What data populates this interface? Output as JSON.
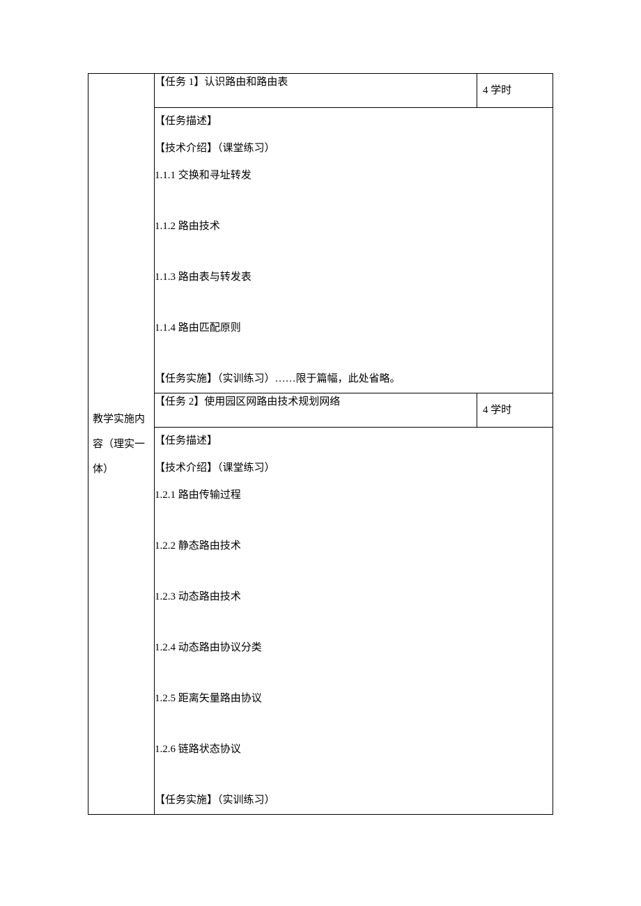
{
  "leftHeader": "教学实施内容（理实一体）",
  "task1": {
    "title": "【任务 1】认识路由和路由表",
    "hours": "4 学时",
    "desc": "【任务描述】",
    "tech": "【技术介绍】（课堂练习）",
    "items": {
      "i1": "1.1.1  交换和寻址转发",
      "i2": "1.1.2  路由技术",
      "i3": "1.1.3  路由表与转发表",
      "i4": "1.1.4  路由匹配原则"
    },
    "impl": "【任务实施】（实训练习）……限于篇幅，此处省略。"
  },
  "task2": {
    "title": "【任务 2】使用园区网路由技术规划网络",
    "hours": "4 学时",
    "desc": "【任务描述】",
    "tech": "【技术介绍】（课堂练习）",
    "items": {
      "i1": "1.2.1 路由传输过程",
      "i2": "1.2.2 静态路由技术",
      "i3": "1.2.3 动态路由技术",
      "i4": "1.2.4 动态路由协议分类",
      "i5": "1.2.5 距离矢量路由协议",
      "i6": "1.2.6 链路状态协议"
    },
    "impl": "【任务实施】（实训练习）"
  }
}
